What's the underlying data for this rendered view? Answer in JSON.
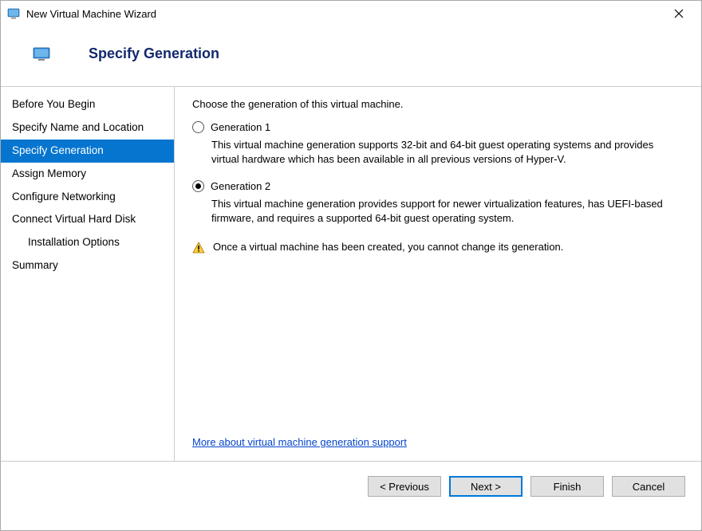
{
  "window": {
    "title": "New Virtual Machine Wizard"
  },
  "header": {
    "title": "Specify Generation"
  },
  "sidebar": {
    "items": [
      {
        "label": "Before You Begin",
        "selected": false,
        "indent": false
      },
      {
        "label": "Specify Name and Location",
        "selected": false,
        "indent": false
      },
      {
        "label": "Specify Generation",
        "selected": true,
        "indent": false
      },
      {
        "label": "Assign Memory",
        "selected": false,
        "indent": false
      },
      {
        "label": "Configure Networking",
        "selected": false,
        "indent": false
      },
      {
        "label": "Connect Virtual Hard Disk",
        "selected": false,
        "indent": false
      },
      {
        "label": "Installation Options",
        "selected": false,
        "indent": true
      },
      {
        "label": "Summary",
        "selected": false,
        "indent": false
      }
    ]
  },
  "main": {
    "instruction": "Choose the generation of this virtual machine.",
    "options": [
      {
        "label": "Generation 1",
        "selected": false,
        "description": "This virtual machine generation supports 32-bit and 64-bit guest operating systems and provides virtual hardware which has been available in all previous versions of Hyper-V."
      },
      {
        "label": "Generation 2",
        "selected": true,
        "description": "This virtual machine generation provides support for newer virtualization features, has UEFI-based firmware, and requires a supported 64-bit guest operating system."
      }
    ],
    "note": "Once a virtual machine has been created, you cannot change its generation.",
    "link": "More about virtual machine generation support"
  },
  "footer": {
    "buttons": {
      "previous": "< Previous",
      "next": "Next >",
      "finish": "Finish",
      "cancel": "Cancel"
    }
  }
}
